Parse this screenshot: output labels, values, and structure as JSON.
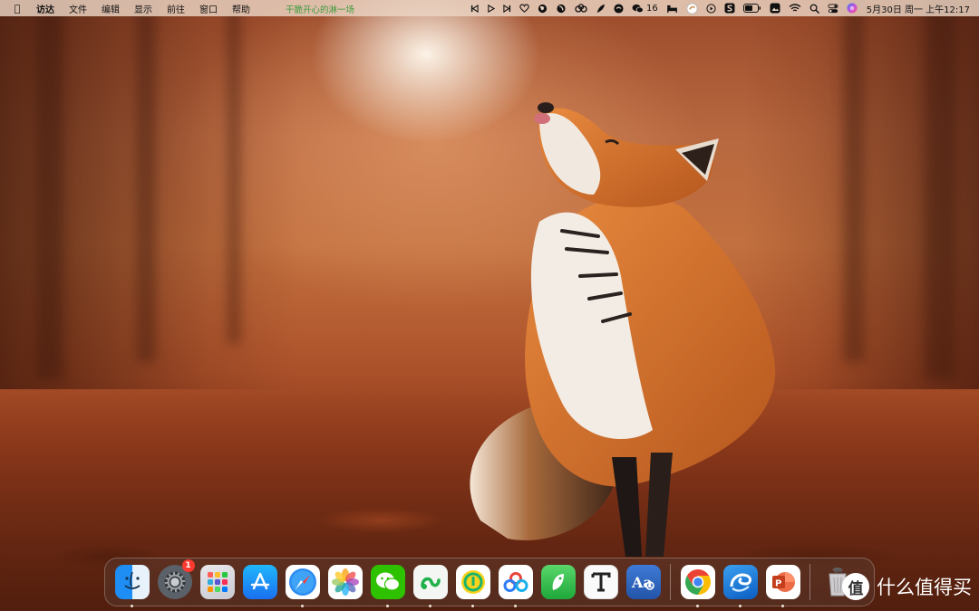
{
  "menubar": {
    "app_name": "访达",
    "menus": [
      "文件",
      "编辑",
      "显示",
      "前往",
      "窗口",
      "帮助"
    ],
    "now_playing": "干脆开心的淋一场",
    "wechat_count": "16",
    "clock": "5月30日 周一 上午12:17"
  },
  "dock": {
    "apps": [
      {
        "name": "finder-app",
        "running": true
      },
      {
        "name": "system-preferences-app",
        "running": false,
        "badge": "1"
      },
      {
        "name": "launchpad-app",
        "running": false
      },
      {
        "name": "app-store-app",
        "running": false
      },
      {
        "name": "safari-app",
        "running": true
      },
      {
        "name": "photos-app",
        "running": false
      },
      {
        "name": "wechat-app",
        "running": true
      },
      {
        "name": "evernote-green-app",
        "running": true
      },
      {
        "name": "qq-music-app",
        "running": true
      },
      {
        "name": "baidu-netdisk-app",
        "running": true
      },
      {
        "name": "green-app",
        "running": false
      },
      {
        "name": "typora-app",
        "running": false
      },
      {
        "name": "dictionary-app",
        "running": false
      }
    ],
    "apps2": [
      {
        "name": "chrome-app",
        "running": true
      },
      {
        "name": "edge-app",
        "running": true
      },
      {
        "name": "powerpoint-app",
        "running": true
      }
    ],
    "trash": "trash-icon"
  },
  "watermark": {
    "mark": "值",
    "text": "什么值得买"
  },
  "colors": {
    "menubar": "#ecd6c4",
    "now_playing": "#3a9a3a",
    "badge": "#ff3b30"
  }
}
